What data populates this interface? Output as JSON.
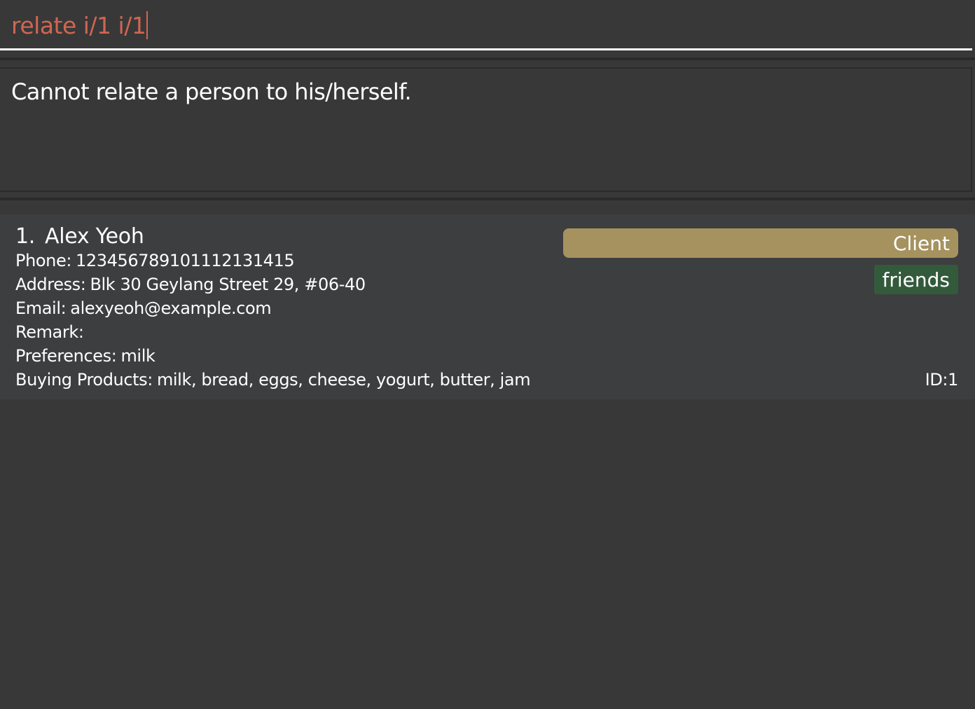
{
  "command_box": {
    "value": "relate i/1 i/1",
    "text_color": "#d06651"
  },
  "result_display": {
    "message": "Cannot relate a person to his/herself."
  },
  "person_list": {
    "persons": [
      {
        "index": "1.",
        "name": "Alex Yeoh",
        "phone_label": "Phone:",
        "phone": "123456789101112131415",
        "address_label": "Address:",
        "address": "Blk 30 Geylang Street 29, #06-40",
        "email_label": "Email:",
        "email": "alexyeoh@example.com",
        "remark_label": "Remark:",
        "remark": "",
        "preferences_label": "Preferences:",
        "preferences": "milk",
        "buying_label": "Buying Products:",
        "buying_products": "milk, bread, eggs, cheese, yogurt, butter, jam",
        "role": "Client",
        "role_color": "#a6925f",
        "tags": [
          "friends"
        ],
        "tag_color": "#345a3c",
        "id_label": "ID:",
        "id": "1"
      }
    ]
  },
  "colors": {
    "background": "#383838",
    "card_background": "#3c3e3f",
    "divider": "#2b2b2b",
    "text": "#ffffff"
  }
}
